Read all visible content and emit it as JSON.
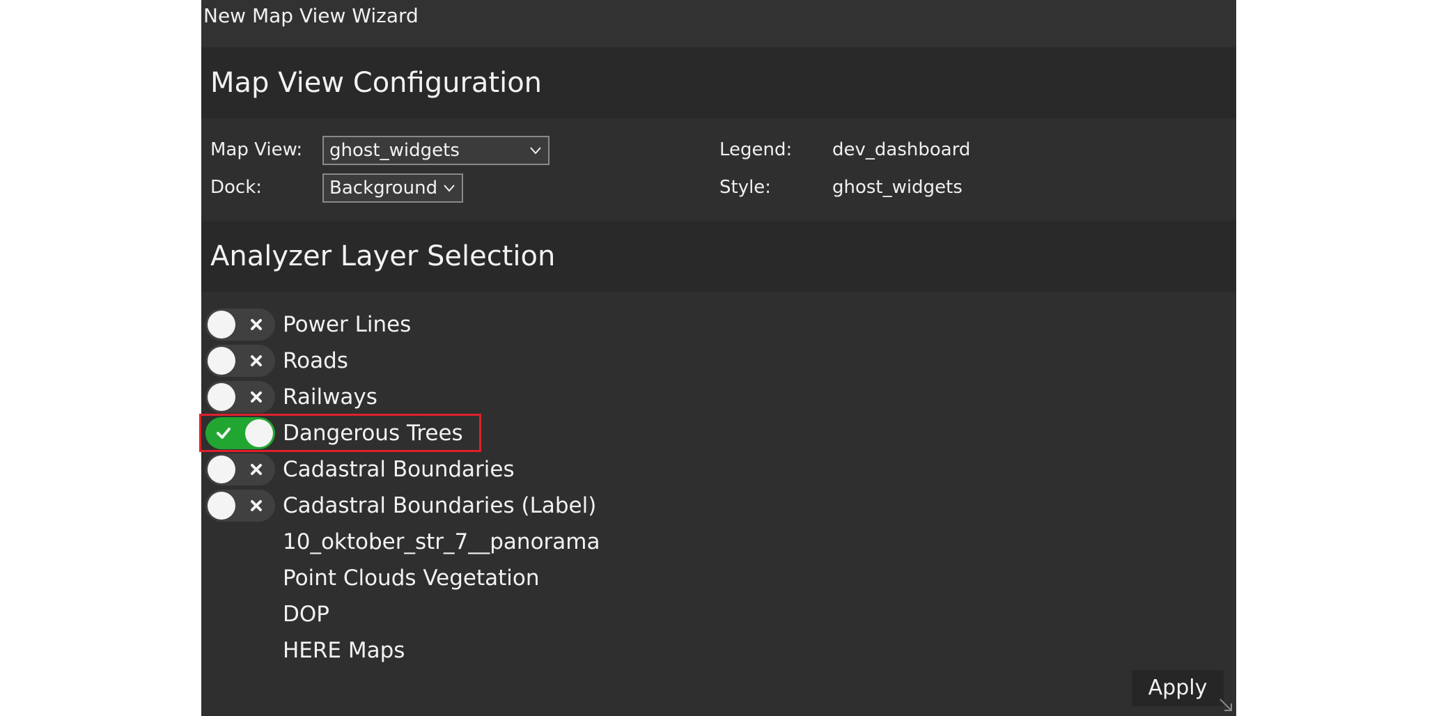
{
  "window": {
    "title": "New Map View Wizard"
  },
  "config": {
    "heading": "Map View Configuration",
    "map_view_label": "Map View:",
    "map_view_value": "ghost_widgets",
    "dock_label": "Dock:",
    "dock_value": "Background",
    "legend_label": "Legend:",
    "legend_value": "dev_dashboard",
    "style_label": "Style:",
    "style_value": "ghost_widgets"
  },
  "layers": {
    "heading": "Analyzer Layer Selection",
    "items": [
      {
        "label": "Power Lines",
        "has_toggle": true,
        "enabled": false
      },
      {
        "label": "Roads",
        "has_toggle": true,
        "enabled": false
      },
      {
        "label": "Railways",
        "has_toggle": true,
        "enabled": false
      },
      {
        "label": "Dangerous Trees",
        "has_toggle": true,
        "enabled": true
      },
      {
        "label": "Cadastral Boundaries",
        "has_toggle": true,
        "enabled": false
      },
      {
        "label": "Cadastral Boundaries (Label)",
        "has_toggle": true,
        "enabled": false
      },
      {
        "label": "10_oktober_str_7__panorama",
        "has_toggle": false
      },
      {
        "label": "Point Clouds Vegetation",
        "has_toggle": false
      },
      {
        "label": "DOP",
        "has_toggle": false
      },
      {
        "label": "HERE Maps",
        "has_toggle": false
      }
    ]
  },
  "footer": {
    "apply_label": "Apply"
  },
  "icons": {
    "toggle_on": "check-icon",
    "toggle_off": "x-icon",
    "dropdown": "chevron-down-icon",
    "resize": "resize-grip-icon"
  },
  "colors": {
    "window_bg": "#2f2f2f",
    "header_bg": "#292929",
    "toggle_on": "#21a632",
    "toggle_off": "#404040",
    "highlight": "#e0202a"
  }
}
